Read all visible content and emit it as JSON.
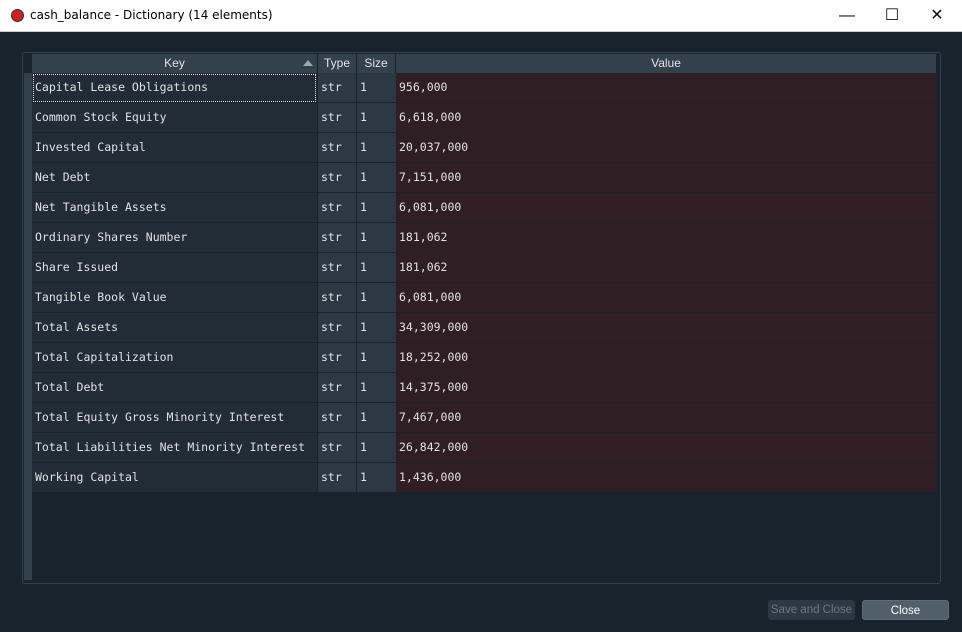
{
  "window": {
    "title": "cash_balance - Dictionary (14 elements)",
    "minimize": "—",
    "maximize": "☐",
    "close": "✕"
  },
  "headers": {
    "key": "Key",
    "type": "Type",
    "size": "Size",
    "value": "Value"
  },
  "rows": [
    {
      "key": "Capital Lease Obligations",
      "type": "str",
      "size": "1",
      "value": "956,000"
    },
    {
      "key": "Common Stock Equity",
      "type": "str",
      "size": "1",
      "value": "6,618,000"
    },
    {
      "key": "Invested Capital",
      "type": "str",
      "size": "1",
      "value": "20,037,000"
    },
    {
      "key": "Net Debt",
      "type": "str",
      "size": "1",
      "value": "7,151,000"
    },
    {
      "key": "Net Tangible Assets",
      "type": "str",
      "size": "1",
      "value": "6,081,000"
    },
    {
      "key": "Ordinary Shares Number",
      "type": "str",
      "size": "1",
      "value": "181,062"
    },
    {
      "key": "Share Issued",
      "type": "str",
      "size": "1",
      "value": "181,062"
    },
    {
      "key": "Tangible Book Value",
      "type": "str",
      "size": "1",
      "value": "6,081,000"
    },
    {
      "key": "Total Assets",
      "type": "str",
      "size": "1",
      "value": "34,309,000"
    },
    {
      "key": "Total Capitalization",
      "type": "str",
      "size": "1",
      "value": "18,252,000"
    },
    {
      "key": "Total Debt",
      "type": "str",
      "size": "1",
      "value": "14,375,000"
    },
    {
      "key": "Total Equity Gross Minority Interest",
      "type": "str",
      "size": "1",
      "value": "7,467,000"
    },
    {
      "key": "Total Liabilities Net Minority Interest",
      "type": "str",
      "size": "1",
      "value": "26,842,000"
    },
    {
      "key": "Working Capital",
      "type": "str",
      "size": "1",
      "value": "1,436,000"
    }
  ],
  "buttons": {
    "save": "Save and Close",
    "close": "Close"
  }
}
